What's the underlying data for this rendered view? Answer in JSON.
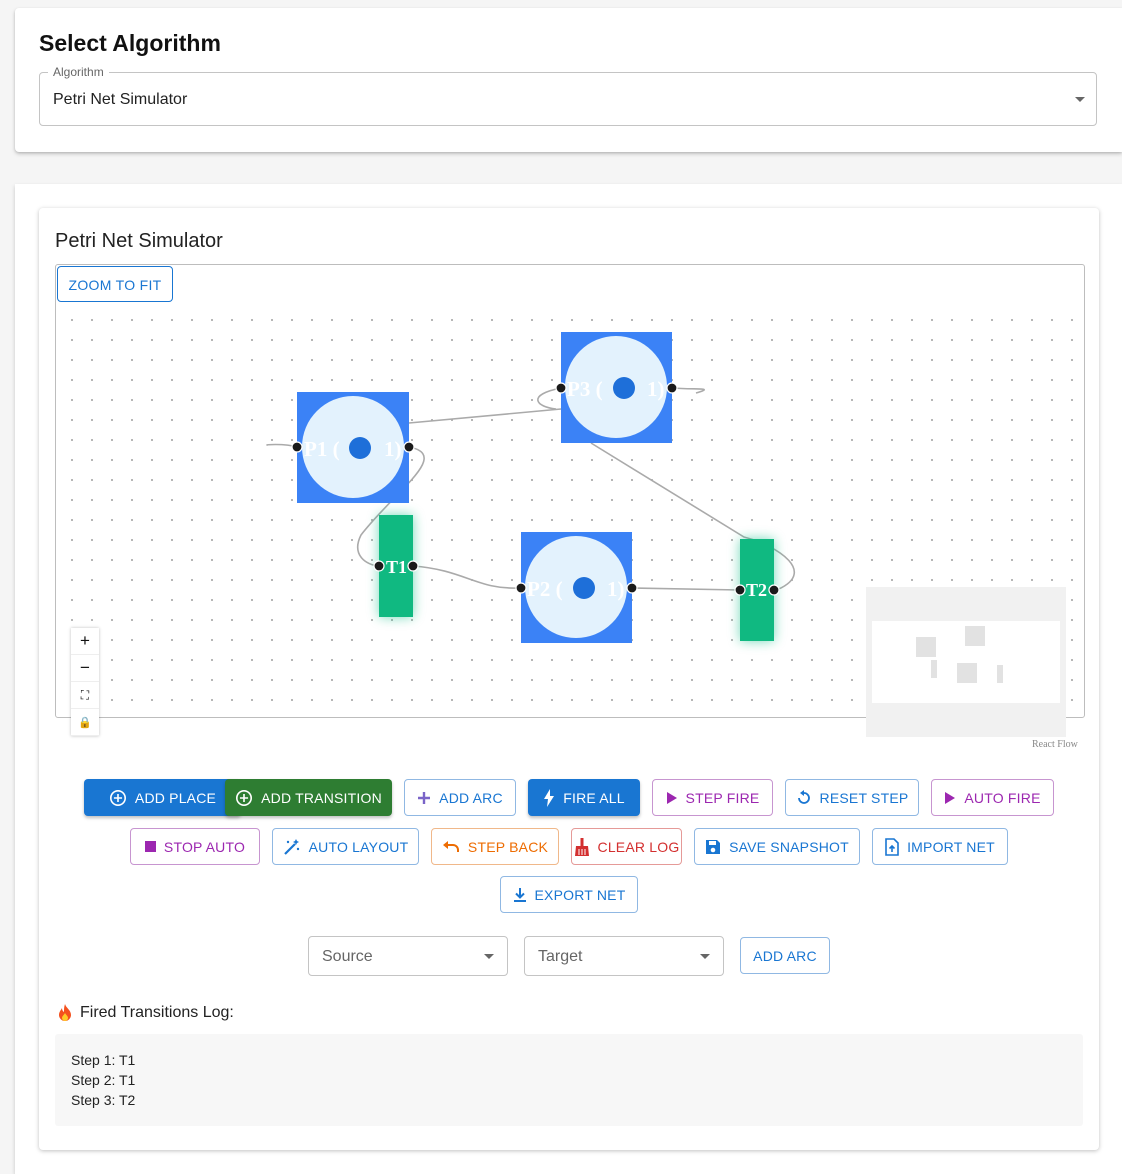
{
  "selector": {
    "heading": "Select Algorithm",
    "label": "Algorithm",
    "value": "Petri Net Simulator"
  },
  "simulator": {
    "title": "Petri Net Simulator",
    "zoom_to_fit": "ZOOM TO FIT",
    "attribution": "React Flow",
    "places": [
      {
        "id": "P1",
        "label": "P1 (",
        "tokens": "1)"
      },
      {
        "id": "P2",
        "label": "P2 (",
        "tokens": "1)"
      },
      {
        "id": "P3",
        "label": "P3 (",
        "tokens": "1)"
      }
    ],
    "transitions": [
      {
        "id": "T1",
        "label": "T1"
      },
      {
        "id": "T2",
        "label": "T2"
      }
    ],
    "controls": [
      "+",
      "−",
      "⛶",
      "🔒"
    ],
    "colors": {
      "place": "#3b82f6",
      "place_inner": "#e3f2fd",
      "transition": "#10b981",
      "token": "#1e6fd9"
    }
  },
  "toolbar": {
    "add_place": "ADD PLACE",
    "add_transition": "ADD TRANSITION",
    "add_arc": "ADD ARC",
    "fire_all": "FIRE ALL",
    "step_fire": "STEP FIRE",
    "reset_step": "RESET STEP",
    "auto_fire": "AUTO FIRE",
    "stop_auto": "STOP AUTO",
    "auto_layout": "AUTO LAYOUT",
    "step_back": "STEP BACK",
    "clear_log": "CLEAR LOG",
    "save_snapshot": "SAVE SNAPSHOT",
    "import_net": "IMPORT NET",
    "export_net": "EXPORT NET"
  },
  "arc_form": {
    "source_placeholder": "Source",
    "target_placeholder": "Target",
    "add_arc": "ADD ARC"
  },
  "log": {
    "heading": "Fired Transitions Log:",
    "entries": [
      "Step 1: T1",
      "Step 2: T1",
      "Step 3: T2"
    ]
  }
}
